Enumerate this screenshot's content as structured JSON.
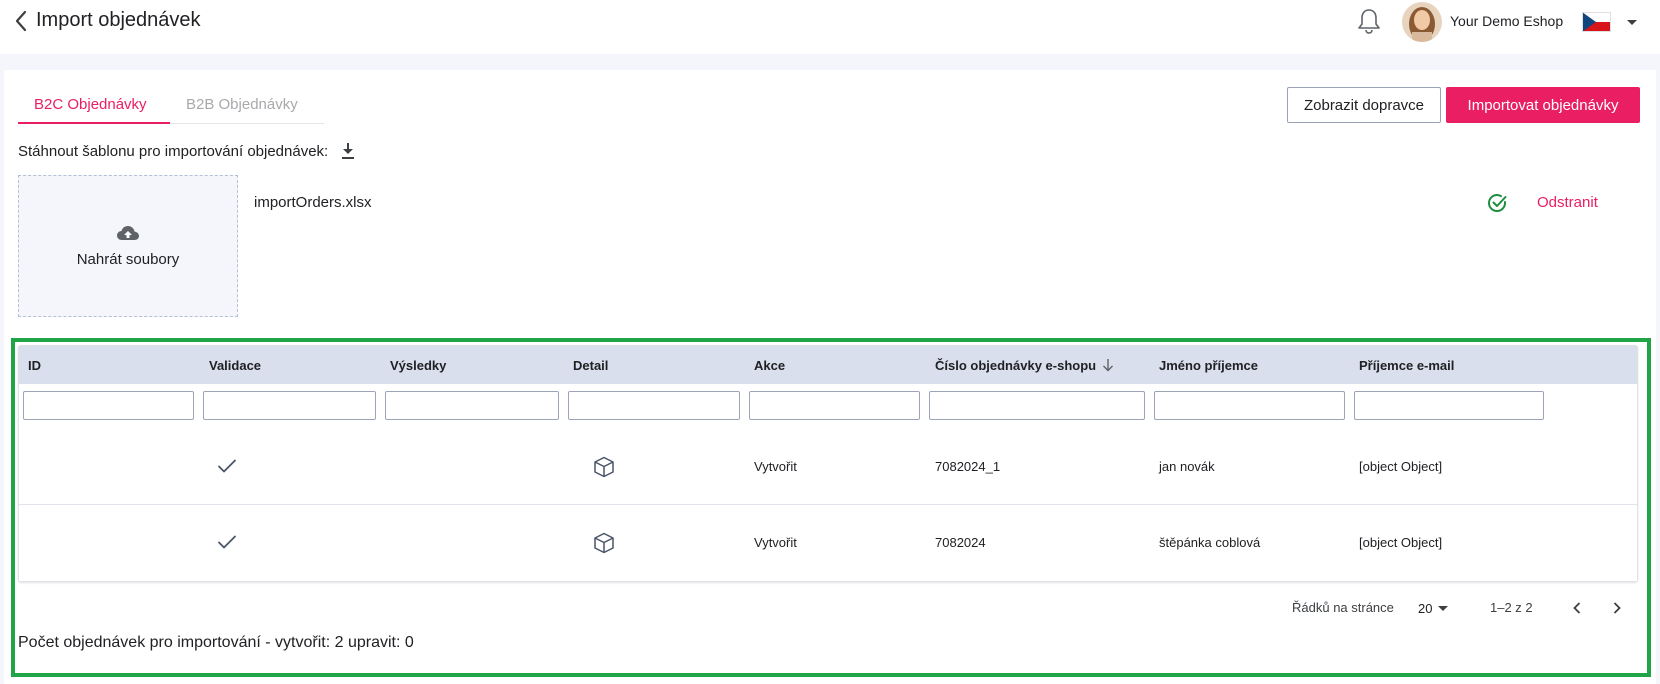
{
  "header": {
    "title": "Import objednávek",
    "shop_name": "Your Demo Eshop"
  },
  "tabs": [
    {
      "label": "B2C Objednávky",
      "active": true
    },
    {
      "label": "B2B Objednávky",
      "active": false
    }
  ],
  "actions": {
    "show_carriers": "Zobrazit dopravce",
    "import_orders": "Importovat objednávky"
  },
  "template": {
    "label": "Stáhnout šablonu pro importování objednávek:"
  },
  "upload": {
    "label": "Nahrát soubory",
    "file_name": "importOrders.xlsx",
    "remove_label": "Odstranit"
  },
  "table": {
    "columns": [
      "ID",
      "Validace",
      "Výsledky",
      "Detail",
      "Akce",
      "Číslo objednávky e-shopu",
      "Jméno příjemce",
      "Příjemce e-mail"
    ],
    "rows": [
      {
        "id": "",
        "validation": "valid",
        "results": "",
        "detail": "cube-icon",
        "action": "Vytvořit",
        "order_number": "7082024_1",
        "recipient_name": "jan novák",
        "recipient_email": "[object Object]"
      },
      {
        "id": "",
        "validation": "valid",
        "results": "",
        "detail": "cube-icon",
        "action": "Vytvořit",
        "order_number": "7082024",
        "recipient_name": "štěpánka coblová",
        "recipient_email": "[object Object]"
      }
    ]
  },
  "pagination": {
    "rows_per_page_label": "Řádků na stránce",
    "rows_per_page": "20",
    "range": "1–2 z 2"
  },
  "summary": "Počet objednávek pro importování - vytvořit: 2 upravit: 0",
  "colors": {
    "accent": "#e91e63",
    "success": "#1e8e3e",
    "highlight": "#1fa548",
    "table_header": "#d9dfec"
  }
}
